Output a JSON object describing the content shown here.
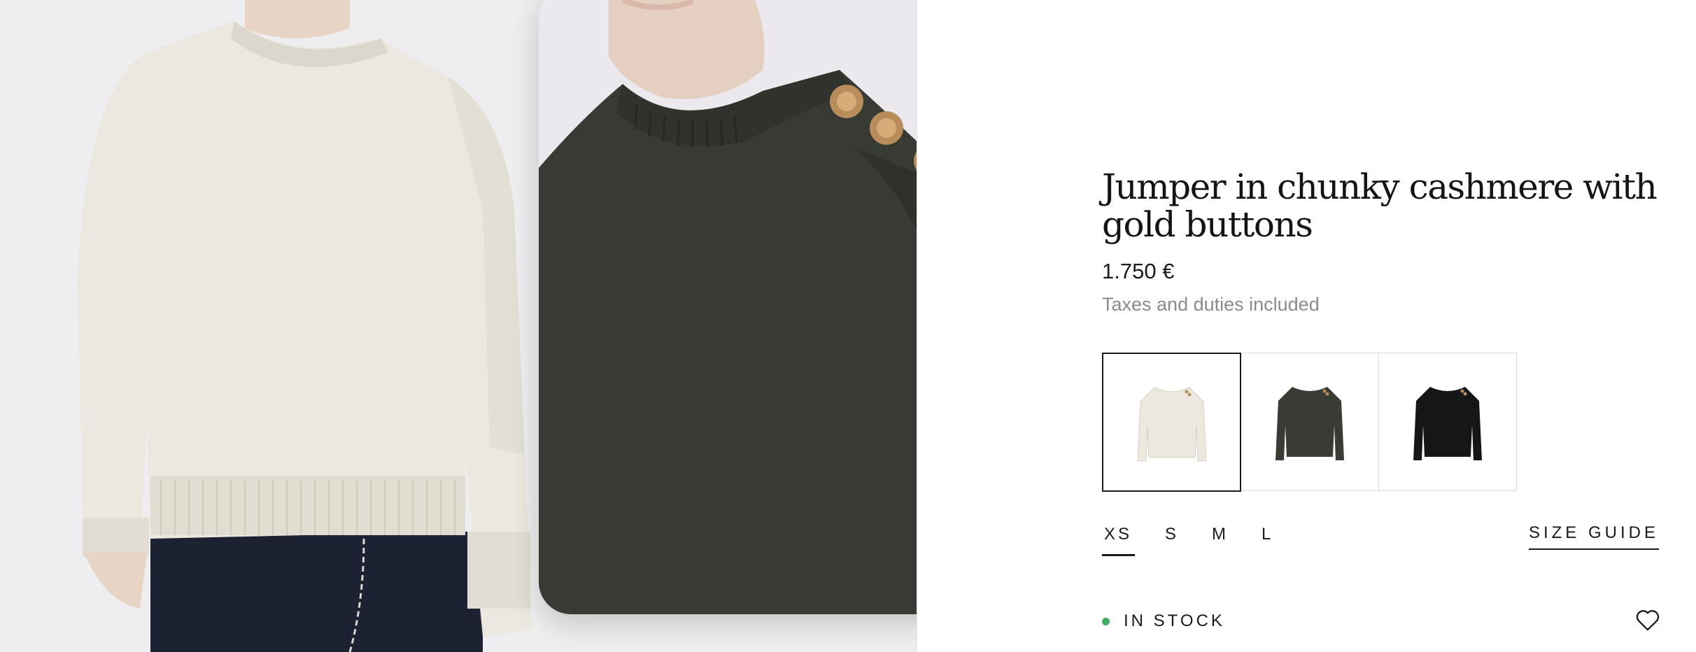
{
  "product": {
    "title": "Jumper in chunky cashmere with gold buttons",
    "price": "1.750 €",
    "tax_note": "Taxes and duties included"
  },
  "gallery": {
    "images": [
      {
        "name": "cream-model-image",
        "color": "#ece8df"
      },
      {
        "name": "green-zoom-image",
        "color": "#373b33"
      }
    ]
  },
  "swatches": [
    {
      "color_name": "cream",
      "color": "#ece8df",
      "selected": true
    },
    {
      "color_name": "green",
      "color": "#393c34",
      "selected": false
    },
    {
      "color_name": "black",
      "color": "#161616",
      "selected": false
    }
  ],
  "sizes": {
    "options": [
      "XS",
      "S",
      "M",
      "L"
    ],
    "selected": "XS",
    "guide_label": "SIZE GUIDE"
  },
  "availability": {
    "label": "IN STOCK",
    "status_color": "#3fae63"
  },
  "icons": {
    "wishlist": "heart-icon"
  }
}
